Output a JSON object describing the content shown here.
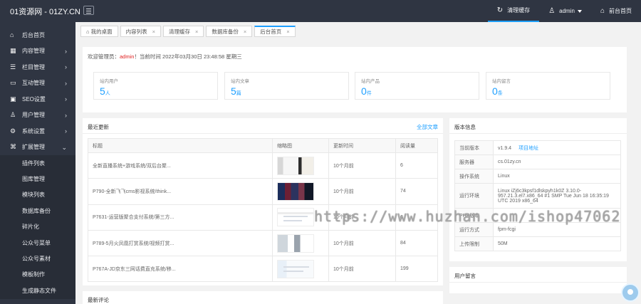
{
  "topbar": {
    "logo": "01资源网 - 01ZY.CN",
    "menu_icon": "menu-icon",
    "clear_cache": "清理缓存",
    "admin": "admin",
    "front_home": "前台首页"
  },
  "sidebar": {
    "items": [
      {
        "label": "后台首页",
        "icon": "home-icon"
      },
      {
        "label": "内容管理",
        "icon": "grid-icon"
      },
      {
        "label": "栏目管理",
        "icon": "list-icon"
      },
      {
        "label": "互动管理",
        "icon": "chat-icon"
      },
      {
        "label": "SEO设置",
        "icon": "monitor-icon"
      },
      {
        "label": "用户管理",
        "icon": "user-icon"
      },
      {
        "label": "系统设置",
        "icon": "gear-icon"
      },
      {
        "label": "扩展管理",
        "icon": "extension-icon"
      }
    ],
    "submenu": [
      "插件列表",
      "图库管理",
      "模块列表",
      "数据库备份",
      "碎片化",
      "公众号菜单",
      "公众号素材",
      "模板制作",
      "生成静态文件"
    ]
  },
  "tabs": [
    {
      "label": "我的桌面",
      "close": ""
    },
    {
      "label": "内容列表",
      "close": "×"
    },
    {
      "label": "清理缓存",
      "close": "×"
    },
    {
      "label": "数据库备份",
      "close": "×"
    },
    {
      "label": "后台首页",
      "close": "×"
    }
  ],
  "welcome": {
    "prefix": "欢迎管理员：",
    "user": "admin",
    "suffix": "！当前时间 2022年03月30日 23:48:58 星期三"
  },
  "stats": [
    {
      "label": "站内用户",
      "value": "5",
      "unit": "人"
    },
    {
      "label": "站内文章",
      "value": "5",
      "unit": "篇"
    },
    {
      "label": "站内产品",
      "value": "0",
      "unit": "件"
    },
    {
      "label": "站内留言",
      "value": "0",
      "unit": "条"
    }
  ],
  "recent": {
    "title": "最近更新",
    "link": "全部文章",
    "headers": [
      "标题",
      "缩略图",
      "更新时间",
      "阅读量"
    ],
    "rows": [
      {
        "title": "全新直播系统+游戏系统/双后台聚...",
        "time": "10个月前",
        "views": "6"
      },
      {
        "title": "P790-全新飞飞cms影视系统/think...",
        "time": "10个月前",
        "views": "74"
      },
      {
        "title": "P7631-运营版聚合支付系统/第三方...",
        "time": "10个月前",
        "views": "6"
      },
      {
        "title": "P789-5月火凤凰打赏系统/视频打赏...",
        "time": "10个月前",
        "views": "84"
      },
      {
        "title": "P767A-JD京东三网话费直充系统/移...",
        "time": "10个月前",
        "views": "199"
      }
    ]
  },
  "comments": {
    "title": "最新评论"
  },
  "system": {
    "title": "版本信息",
    "rows": [
      {
        "label": "当前版本",
        "value": "v1.9.4",
        "link": "项目地址"
      },
      {
        "label": "服务器",
        "value": "cs.01zy.cn",
        "link": ""
      },
      {
        "label": "操作系统",
        "value": "Linux",
        "link": ""
      },
      {
        "label": "运行环境",
        "value": "Linux iZj6c3kpsf1dlskpyh1k0Z 3.10.0-957.21.3.el7.x86_64 #1 SMP Tue Jun 18 16:35:19 UTC 2019 x86_64",
        "link": ""
      },
      {
        "label": "PHP版本",
        "value": "",
        "link": ""
      },
      {
        "label": "运行方式",
        "value": "fpm-fcgi",
        "link": ""
      },
      {
        "label": "上传限制",
        "value": "50M",
        "link": ""
      }
    ]
  },
  "messages": {
    "title": "用户留言"
  },
  "watermark": "https://www.huzhan.com/ishop47062",
  "colors": {
    "topbar": "#2f3542",
    "accent": "#1e9fff",
    "highlight": "#e02020"
  }
}
